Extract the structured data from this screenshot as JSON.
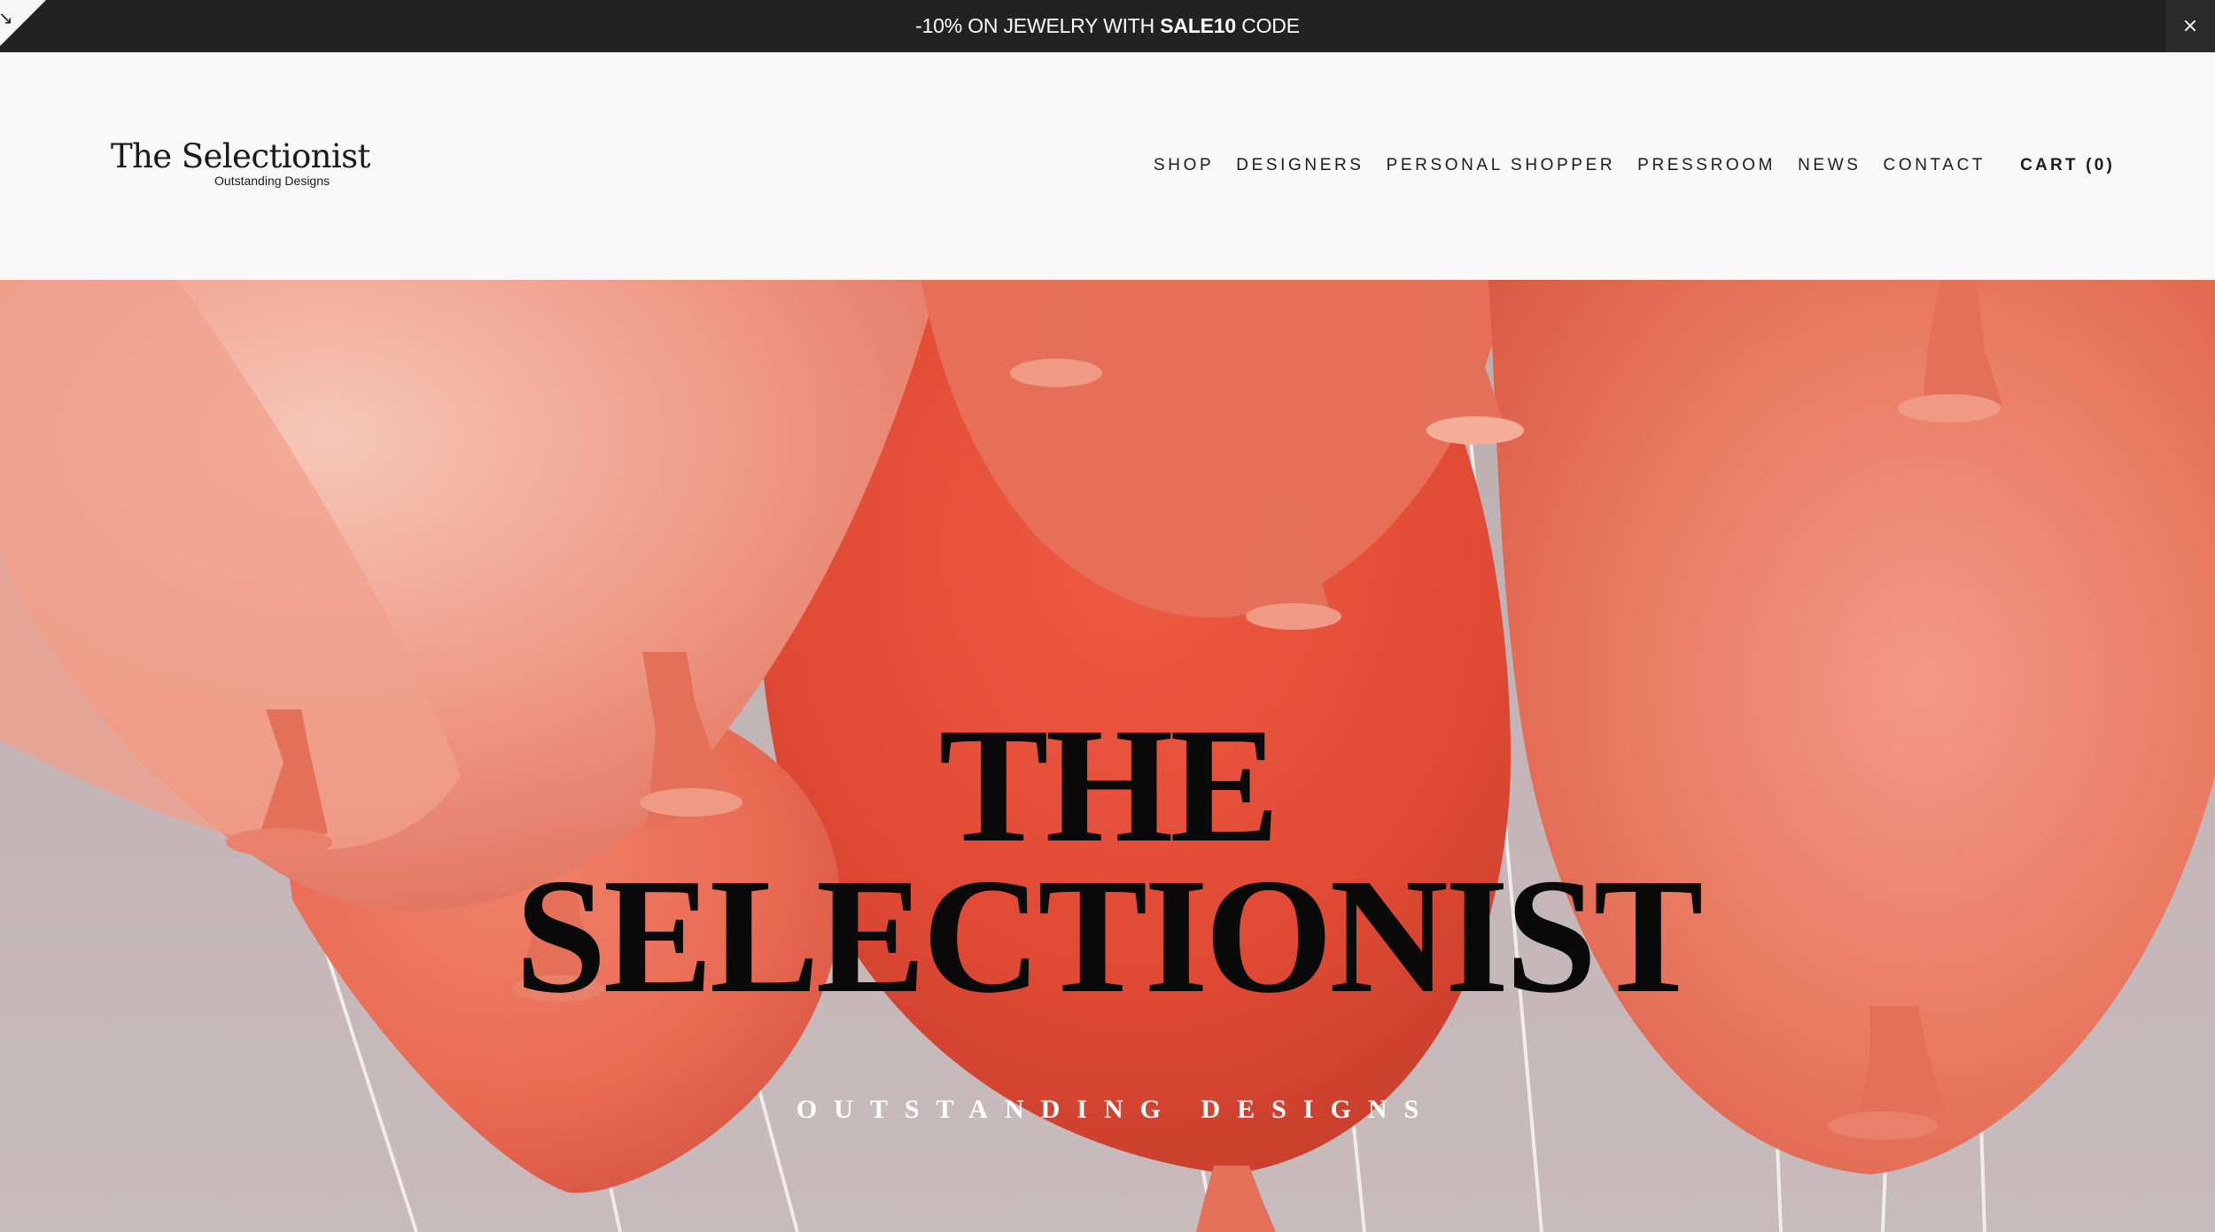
{
  "announcement": {
    "prefix": "-10% ON JEWELRY WITH",
    "code": "SALE10",
    "suffix": "CODE",
    "close_glyph": "×",
    "corner_glyph": "↘"
  },
  "logo": {
    "title": "The Selectionist",
    "subtitle": "Outstanding Designs"
  },
  "nav": {
    "items": [
      {
        "label": "SHOP"
      },
      {
        "label": "DESIGNERS"
      },
      {
        "label": "PERSONAL SHOPPER"
      },
      {
        "label": "PRESSROOM"
      },
      {
        "label": "NEWS"
      },
      {
        "label": "CONTACT"
      }
    ],
    "cart": "CART (0)"
  },
  "hero": {
    "title_line1": "THE",
    "title_line2": "SELECTIONIST",
    "subtitle": "OUTSTANDING DESIGNS",
    "image": "red-balloons-photo"
  },
  "colors": {
    "announce_bg": "#222222",
    "header_bg": "#f8f8f8",
    "balloon": "#e8553f",
    "backdrop": "#c4b6b8"
  }
}
